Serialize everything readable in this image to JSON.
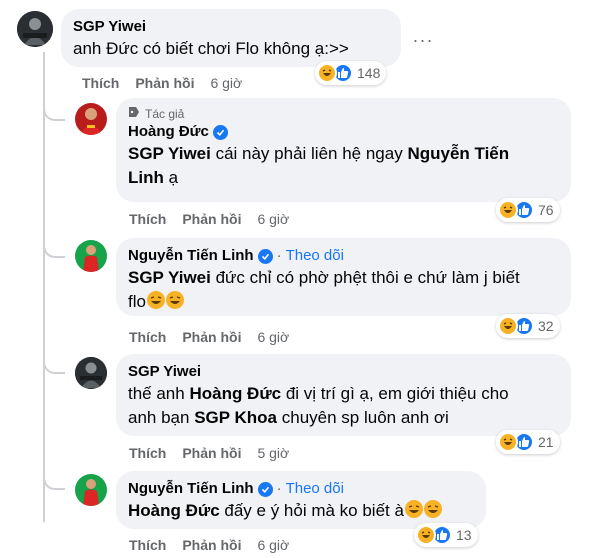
{
  "comments": [
    {
      "name": "SGP Yiwei",
      "segments": [
        {
          "text": "anh Đức có biết chơi Flo không ạ:>>",
          "bold": false
        }
      ],
      "like_label": "Thích",
      "reply_label": "Phản hồi",
      "time": "6 giờ",
      "reaction_count": "148",
      "more_label": "···"
    },
    {
      "author_badge": "Tác giả",
      "name": "Hoàng Đức",
      "line1": [
        {
          "text": "SGP Yiwei",
          "bold": true
        },
        {
          "text": " cái này phải liên hệ ngay ",
          "bold": false
        },
        {
          "text": "Nguyễn Tiến",
          "bold": true
        }
      ],
      "line2": [
        {
          "text": "Linh",
          "bold": true
        },
        {
          "text": " ạ",
          "bold": false
        }
      ],
      "like_label": "Thích",
      "reply_label": "Phản hồi",
      "time": "6 giờ",
      "reaction_count": "76"
    },
    {
      "name": "Nguyễn Tiến Linh",
      "follow_label": "Theo dõi",
      "separator": "·",
      "line1": [
        {
          "text": "SGP Yiwei",
          "bold": true
        },
        {
          "text": " đức chỉ có phờ phệt thôi e chứ làm j biết",
          "bold": false
        }
      ],
      "line2": [
        {
          "text": "flo",
          "bold": false
        }
      ],
      "like_label": "Thích",
      "reply_label": "Phản hồi",
      "time": "6 giờ",
      "reaction_count": "32"
    },
    {
      "name": "SGP Yiwei",
      "line1": [
        {
          "text": "thế anh ",
          "bold": false
        },
        {
          "text": "Hoàng Đức",
          "bold": true
        },
        {
          "text": " đi vị trí gì ạ, em giới thiệu cho",
          "bold": false
        }
      ],
      "line2": [
        {
          "text": "anh bạn ",
          "bold": false
        },
        {
          "text": "SGP Khoa",
          "bold": true
        },
        {
          "text": " chuyên sp luôn anh ơi",
          "bold": false
        }
      ],
      "like_label": "Thích",
      "reply_label": "Phản hồi",
      "time": "5 giờ",
      "reaction_count": "21"
    },
    {
      "name": "Nguyễn Tiến Linh",
      "follow_label": "Theo dõi",
      "separator": "·",
      "line1": [
        {
          "text": "Hoàng Đức",
          "bold": true
        },
        {
          "text": " đấy e ý hỏi mà ko biết à",
          "bold": false
        }
      ],
      "like_label": "Thích",
      "reply_label": "Phản hồi",
      "time": "6 giờ",
      "reaction_count": "13"
    }
  ],
  "icons": {
    "verified": "verified-badge-icon",
    "haha": "haha-reaction-icon",
    "like": "like-reaction-icon",
    "author": "author-badge-icon"
  },
  "colors": {
    "bubble": "#f0f2f5",
    "accent": "#1877f2",
    "muted": "#65676b",
    "haha": "#f7b125"
  }
}
